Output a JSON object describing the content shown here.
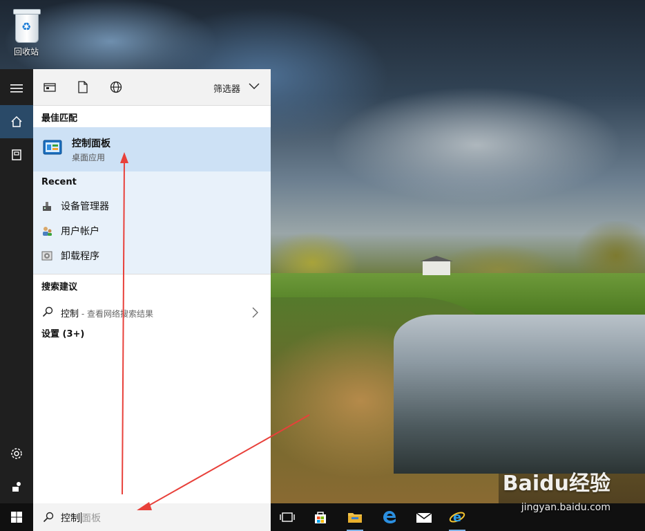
{
  "desktop": {
    "recycle_bin_label": "回收站"
  },
  "start_panel": {
    "filter_label": "筛选器",
    "best_match": {
      "heading": "最佳匹配",
      "title": "控制面板",
      "subtitle": "桌面应用"
    },
    "recent": {
      "heading": "Recent",
      "items": [
        {
          "label": "设备管理器",
          "icon": "device-manager-icon"
        },
        {
          "label": "用户帐户",
          "icon": "user-accounts-icon"
        },
        {
          "label": "卸载程序",
          "icon": "uninstall-programs-icon"
        }
      ]
    },
    "suggestions": {
      "heading": "搜索建议",
      "query": "控制",
      "sub": " - 查看网络搜索结果"
    },
    "settings_label": "设置 (3+)"
  },
  "search": {
    "typed": "控制",
    "suggestion_ghost": "面板"
  },
  "watermark": {
    "brand": "Baidu经验",
    "url": "jingyan.baidu.com"
  },
  "colors": {
    "accent": "#2a4a68",
    "highlight": "#cde1f5",
    "annotation_arrow": "#e8403a"
  }
}
